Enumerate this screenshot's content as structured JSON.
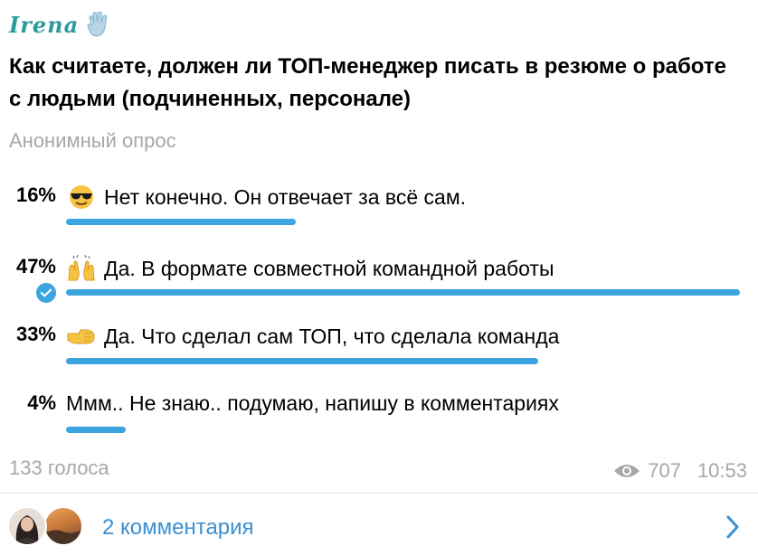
{
  "author": {
    "name": "Irena"
  },
  "poll": {
    "question": "Как считаете, должен ли ТОП-менеджер писать в резюме о работе с людьми (подчиненных, персонале)",
    "type": "Анонимный опрос",
    "options": [
      {
        "percent_label": "16%",
        "percent": 16,
        "emoji": "smiling-face-sunglasses",
        "text": "Нет конечно. Он отвечает за всё сам.",
        "selected": false
      },
      {
        "percent_label": "47%",
        "percent": 47,
        "emoji": "raising-hands",
        "text": "Да. В формате совместной командной работы",
        "selected": true
      },
      {
        "percent_label": "33%",
        "percent": 33,
        "emoji": "right-facing-fist",
        "text": "Да. Что сделал сам ТОП, что сделала команда",
        "selected": false
      },
      {
        "percent_label": "4%",
        "percent": 4,
        "emoji": "",
        "text": "Ммм.. Не знаю.. подумаю, напишу в комментариях",
        "selected": false
      }
    ],
    "votes": "133 голоса"
  },
  "meta": {
    "views": "707",
    "time": "10:53"
  },
  "comments": {
    "label": "2 комментария"
  },
  "colors": {
    "accent": "#3ca5e0",
    "muted": "#a7a7a7",
    "author": "#2a9a9d",
    "link": "#3a8fd1"
  }
}
